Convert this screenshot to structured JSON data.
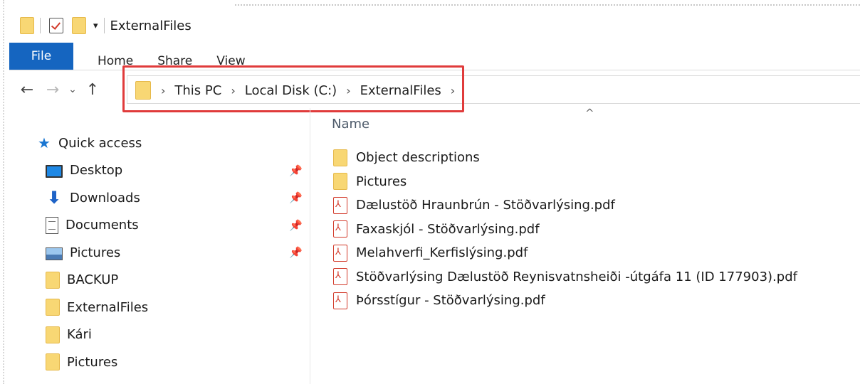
{
  "window": {
    "title": "ExternalFiles"
  },
  "quick_access_toolbar": {
    "customize_arrow": "▾"
  },
  "ribbon": {
    "tabs": [
      "File",
      "Home",
      "Share",
      "View"
    ]
  },
  "navigation": {
    "back": "←",
    "forward": "→",
    "recent": "⌄",
    "up": "↑"
  },
  "address_bar": {
    "crumbs": [
      "This PC",
      "Local Disk (C:)",
      "ExternalFiles"
    ],
    "separator": "›"
  },
  "nav_pane": {
    "quick_access": "Quick access",
    "items": [
      {
        "label": "Desktop",
        "icon": "desktop-icon",
        "pinned": true
      },
      {
        "label": "Downloads",
        "icon": "downloads-icon",
        "pinned": true
      },
      {
        "label": "Documents",
        "icon": "documents-icon",
        "pinned": true
      },
      {
        "label": "Pictures",
        "icon": "pictures-icon",
        "pinned": true
      },
      {
        "label": "BACKUP",
        "icon": "folder-icon",
        "pinned": false
      },
      {
        "label": "ExternalFiles",
        "icon": "folder-icon",
        "pinned": false
      },
      {
        "label": "Kári",
        "icon": "folder-icon",
        "pinned": false
      },
      {
        "label": "Pictures",
        "icon": "folder-icon",
        "pinned": false
      }
    ]
  },
  "content": {
    "column_header": "Name",
    "sort_indicator": "^",
    "files": [
      {
        "name": "Object descriptions",
        "type": "folder"
      },
      {
        "name": "Pictures",
        "type": "folder"
      },
      {
        "name": "Dælustöð Hraunbrún - Stöðvarlýsing.pdf",
        "type": "pdf"
      },
      {
        "name": "Faxaskjól - Stöðvarlýsing.pdf",
        "type": "pdf"
      },
      {
        "name": "Melahverfi_Kerfislýsing.pdf",
        "type": "pdf"
      },
      {
        "name": "Stöðvarlýsing Dælustöð Reynisvatnsheiði -útgáfa 11 (ID 177903).pdf",
        "type": "pdf"
      },
      {
        "name": "Þórsstígur - Stöðvarlýsing.pdf",
        "type": "pdf"
      }
    ]
  },
  "colors": {
    "file_tab": "#1565c0",
    "highlight": "#e03b3b",
    "folder": "#f8d774",
    "pdf": "#d23a2a"
  }
}
